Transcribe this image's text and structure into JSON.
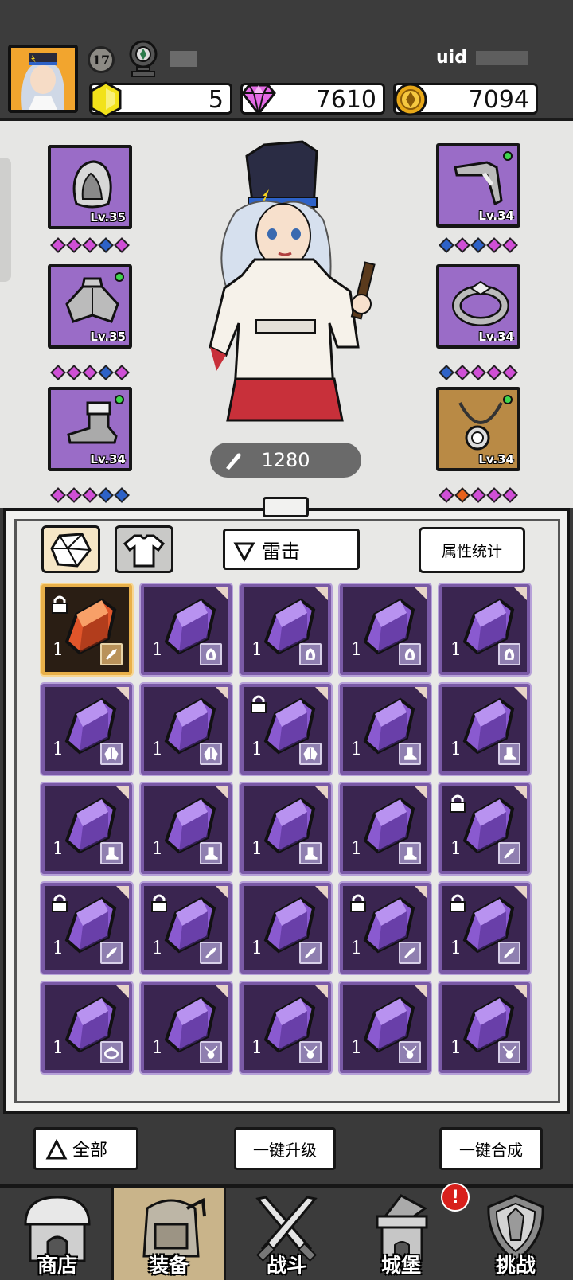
{
  "header": {
    "player_level": "17",
    "uid_label": "uid",
    "currencies": [
      {
        "name": "energy",
        "icon": "yellow-gem-icon",
        "value": "5"
      },
      {
        "name": "diamond",
        "icon": "pink-diamond-icon",
        "value": "7610"
      },
      {
        "name": "gold",
        "icon": "gold-coin-icon",
        "value": "7094"
      }
    ]
  },
  "equipment": {
    "left": [
      {
        "slot": "helmet",
        "icon": "hood-icon",
        "level": "Lv.35",
        "dot": false,
        "gems": [
          "#d04fd6",
          "#d04fd6",
          "#d04fd6",
          "#2d62c8",
          "#d04fd6"
        ]
      },
      {
        "slot": "armor",
        "icon": "cloak-icon",
        "level": "Lv.35",
        "dot": true,
        "gems": [
          "#d04fd6",
          "#d04fd6",
          "#d04fd6",
          "#2d62c8",
          "#d04fd6"
        ]
      },
      {
        "slot": "boots",
        "icon": "boot-icon",
        "level": "Lv.34",
        "dot": true,
        "gems": [
          "#d04fd6",
          "#d04fd6",
          "#d04fd6",
          "#2d62c8",
          "#2d62c8"
        ]
      }
    ],
    "right": [
      {
        "slot": "weapon",
        "icon": "pipe-icon",
        "level": "Lv.34",
        "dot": true,
        "gems": [
          "#2d62c8",
          "#d04fd6",
          "#2d62c8",
          "#d04fd6",
          "#d04fd6"
        ]
      },
      {
        "slot": "ring",
        "icon": "ring-icon",
        "level": "Lv.34",
        "dot": false,
        "gems": [
          "#2d62c8",
          "#d04fd6",
          "#d04fd6",
          "#d04fd6",
          "#d04fd6"
        ]
      },
      {
        "slot": "necklace",
        "icon": "necklace-icon",
        "level": "Lv.34",
        "dot": true,
        "gems": [
          "#d04fd6",
          "#e8621c",
          "#d04fd6",
          "#d04fd6",
          "#d04fd6"
        ]
      }
    ],
    "power": "1280"
  },
  "inventory": {
    "filter_label": "雷击",
    "stats_button": "属性统计",
    "items": [
      {
        "color": "orange",
        "count": "1",
        "locked": true,
        "slot_icon": "weapon-icon"
      },
      {
        "color": "purple",
        "count": "1",
        "locked": false,
        "slot_icon": "helmet-icon"
      },
      {
        "color": "purple",
        "count": "1",
        "locked": false,
        "slot_icon": "helmet-icon"
      },
      {
        "color": "purple",
        "count": "1",
        "locked": false,
        "slot_icon": "helmet-icon"
      },
      {
        "color": "purple",
        "count": "1",
        "locked": false,
        "slot_icon": "helmet-icon"
      },
      {
        "color": "purple",
        "count": "1",
        "locked": false,
        "slot_icon": "cloak-icon"
      },
      {
        "color": "purple",
        "count": "1",
        "locked": false,
        "slot_icon": "cloak-icon"
      },
      {
        "color": "purple",
        "count": "1",
        "locked": true,
        "slot_icon": "cloak-icon"
      },
      {
        "color": "purple",
        "count": "1",
        "locked": false,
        "slot_icon": "boot-icon"
      },
      {
        "color": "purple",
        "count": "1",
        "locked": false,
        "slot_icon": "boot-icon"
      },
      {
        "color": "purple",
        "count": "1",
        "locked": false,
        "slot_icon": "boot-icon"
      },
      {
        "color": "purple",
        "count": "1",
        "locked": false,
        "slot_icon": "boot-icon"
      },
      {
        "color": "purple",
        "count": "1",
        "locked": false,
        "slot_icon": "boot-icon"
      },
      {
        "color": "purple",
        "count": "1",
        "locked": false,
        "slot_icon": "boot-icon"
      },
      {
        "color": "purple",
        "count": "1",
        "locked": true,
        "slot_icon": "weapon-icon"
      },
      {
        "color": "purple",
        "count": "1",
        "locked": true,
        "slot_icon": "weapon-icon"
      },
      {
        "color": "purple",
        "count": "1",
        "locked": true,
        "slot_icon": "weapon-icon"
      },
      {
        "color": "purple",
        "count": "1",
        "locked": false,
        "slot_icon": "weapon-icon"
      },
      {
        "color": "purple",
        "count": "1",
        "locked": true,
        "slot_icon": "weapon-icon"
      },
      {
        "color": "purple",
        "count": "1",
        "locked": true,
        "slot_icon": "weapon-icon"
      },
      {
        "color": "purple",
        "count": "1",
        "locked": false,
        "slot_icon": "ring-icon"
      },
      {
        "color": "purple",
        "count": "1",
        "locked": false,
        "slot_icon": "necklace-icon"
      },
      {
        "color": "purple",
        "count": "1",
        "locked": false,
        "slot_icon": "necklace-icon"
      },
      {
        "color": "purple",
        "count": "1",
        "locked": false,
        "slot_icon": "necklace-icon"
      },
      {
        "color": "purple",
        "count": "1",
        "locked": false,
        "slot_icon": "necklace-icon"
      }
    ]
  },
  "actions": {
    "all_label": "全部",
    "upgrade_all": "一键升级",
    "merge_all": "一键合成"
  },
  "nav": {
    "items": [
      {
        "label": "商店",
        "icon": "shop-icon",
        "active": false
      },
      {
        "label": "装备",
        "icon": "backpack-icon",
        "active": true
      },
      {
        "label": "战斗",
        "icon": "crossed-swords-icon",
        "active": false
      },
      {
        "label": "城堡",
        "icon": "castle-icon",
        "active": false
      },
      {
        "label": "挑战",
        "icon": "shield-icon",
        "active": false
      }
    ],
    "notification_badge": "!"
  }
}
